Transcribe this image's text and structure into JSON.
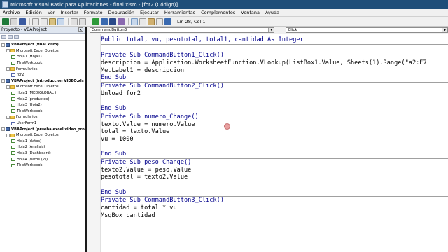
{
  "window": {
    "title": "Microsoft Visual Basic para Aplicaciones - final.xlsm - [for2 (Código)]"
  },
  "menu": [
    "Archivo",
    "Edición",
    "Ver",
    "Insertar",
    "Formato",
    "Depuración",
    "Ejecutar",
    "Herramientas",
    "Complementos",
    "Ventana",
    "Ayuda"
  ],
  "toolbar": {
    "status": "Lín 28, Col 1",
    "colors": {
      "excel": "#1f7a3a",
      "run": "#2e9a3a",
      "pause": "#3a6ab0",
      "stop": "#2a4a8a",
      "design": "#8a6ab0"
    }
  },
  "project_panel": {
    "header": "Proyecto - VBAProject",
    "close_label": "x",
    "tree": [
      {
        "text": "VBAProject (final.xlsm)",
        "level": 0,
        "kind": "proj",
        "expander": "-"
      },
      {
        "text": "Microsoft Excel Objetos",
        "level": 1,
        "kind": "folder",
        "expander": "-"
      },
      {
        "text": "Hoja1 (Hoja1)",
        "level": 2,
        "kind": "sheet"
      },
      {
        "text": "ThisWorkbook",
        "level": 2,
        "kind": "sheet"
      },
      {
        "text": "Formularios",
        "level": 1,
        "kind": "folder",
        "expander": "-"
      },
      {
        "text": "for2",
        "level": 2,
        "kind": "form"
      },
      {
        "text": "VBAProject (introduccion VIDEO.xls",
        "level": 0,
        "kind": "proj",
        "expander": "-"
      },
      {
        "text": "Microsoft Excel Objetos",
        "level": 1,
        "kind": "folder",
        "expander": "-"
      },
      {
        "text": "Hoja1 (MEDIGLOBAL )",
        "level": 2,
        "kind": "sheet"
      },
      {
        "text": "Hoja2 (productes)",
        "level": 2,
        "kind": "sheet"
      },
      {
        "text": "Hoja3 (Hoja2)",
        "level": 2,
        "kind": "sheet"
      },
      {
        "text": "ThisWorkbook",
        "level": 2,
        "kind": "sheet"
      },
      {
        "text": "Formularios",
        "level": 1,
        "kind": "folder",
        "expander": "-"
      },
      {
        "text": "UserForm1",
        "level": 2,
        "kind": "form"
      },
      {
        "text": "VBAProject (prueba excel video_pro",
        "level": 0,
        "kind": "proj",
        "expander": "-"
      },
      {
        "text": "Microsoft Excel Objetos",
        "level": 1,
        "kind": "folder",
        "expander": "-"
      },
      {
        "text": "Hoja1 (datos)",
        "level": 2,
        "kind": "sheet"
      },
      {
        "text": "Hoja2 (Analisis)",
        "level": 2,
        "kind": "sheet"
      },
      {
        "text": "Hoja3 (Dashboard)",
        "level": 2,
        "kind": "sheet"
      },
      {
        "text": "Hoja4 (datos (2))",
        "level": 2,
        "kind": "sheet"
      },
      {
        "text": "ThisWorkbook",
        "level": 2,
        "kind": "sheet"
      }
    ]
  },
  "code_window": {
    "object_combo": "CommandButton3",
    "procedure_combo": "Click",
    "lines": [
      {
        "text": "Public total, vu, pesototal, total1, cantidad As Integer",
        "kw": true
      },
      {
        "sep": true
      },
      {
        "text": ""
      },
      {
        "text": "Private Sub CommandButton1_Click()",
        "kw": true
      },
      {
        "text": "descripcion = Application.WorksheetFunction.VLookup(ListBox1.Value, Sheets(1).Range(\"a2:E7"
      },
      {
        "text": "Me.Label1 = descripcion"
      },
      {
        "text": "End Sub",
        "kw": true
      },
      {
        "sep": true
      },
      {
        "text": "Private Sub CommandButton2_Click()",
        "kw": true
      },
      {
        "text": "Unload for2"
      },
      {
        "text": ""
      },
      {
        "text": "End Sub",
        "kw": true
      },
      {
        "sep": true
      },
      {
        "text": "Private Sub numero_Change()",
        "kw": true
      },
      {
        "text": "texto.Value = numero.Value"
      },
      {
        "text": "total = texto.Value"
      },
      {
        "text": "vu = 1000"
      },
      {
        "text": ""
      },
      {
        "text": "End Sub",
        "kw": true
      },
      {
        "sep": true
      },
      {
        "text": "Private Sub peso_Change()",
        "kw": true
      },
      {
        "text": "texto2.Value = peso.Value"
      },
      {
        "text": "pesototal = texto2.Value"
      },
      {
        "text": ""
      },
      {
        "text": "End Sub",
        "kw": true
      },
      {
        "sep": true
      },
      {
        "text": "Private Sub CommandButton3_Click()",
        "kw": true
      },
      {
        "text": "cantidad = total * vu"
      },
      {
        "text": "MsgBox cantidad"
      }
    ]
  }
}
